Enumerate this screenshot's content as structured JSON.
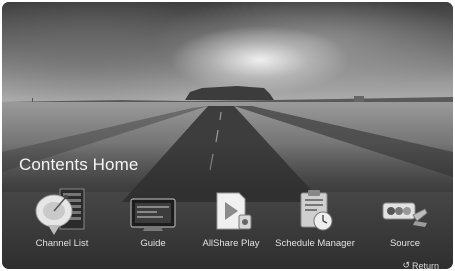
{
  "header": {
    "title": "Contents Home"
  },
  "menu": {
    "items": [
      {
        "label": "Channel List",
        "icon": "satellite-dish-icon"
      },
      {
        "label": "Guide",
        "icon": "tv-guide-icon"
      },
      {
        "label": "AllShare Play",
        "icon": "play-media-icon"
      },
      {
        "label": "Schedule Manager",
        "icon": "schedule-clipboard-icon"
      },
      {
        "label": "Source",
        "icon": "av-source-icon"
      }
    ]
  },
  "footer": {
    "return_label": "Return",
    "return_icon": "return-arrow-icon"
  }
}
